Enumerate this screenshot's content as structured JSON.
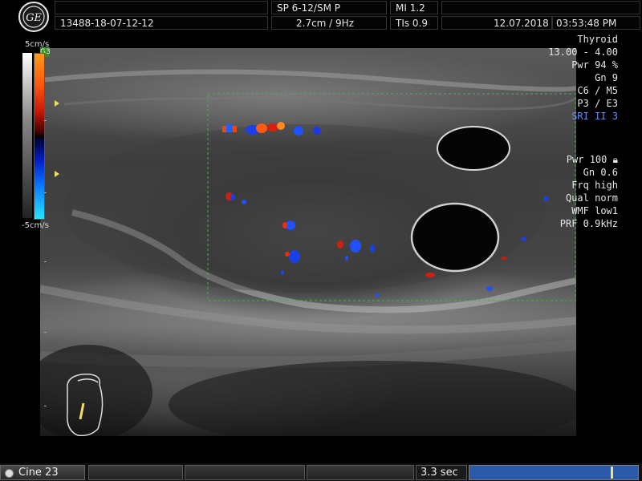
{
  "header": {
    "logo_icon": "ge-logo-icon",
    "logo_text": "GE",
    "probe": "SP 6-12/SM P",
    "mi": "MI 1.2",
    "patient_id": "13488-18-07-12-12",
    "depth_freq": "2.7cm / 9Hz",
    "tis": "TIs 0.9",
    "date": "12.07.2018",
    "time": "03:53:48 PM"
  },
  "color_scale": {
    "top_label": "5cm/s",
    "bottom_label": "-5cm/s",
    "badge": "G3",
    "colors": {
      "positive": "#ff5a10",
      "negative": "#0a78ff",
      "marker": "#f0e060"
    }
  },
  "params_top": [
    "Thyroid",
    "13.00 - 4.00",
    "Pwr  94 %",
    "Gn  9",
    "C6 / M5",
    "P3 / E3",
    "SRI II 3"
  ],
  "params_color": [
    "Pwr 100",
    "Gn  0.6",
    "Frq high",
    "Qual norm",
    "WMF low1",
    "PRF  0.9kHz"
  ],
  "lock_icon": "lock-icon",
  "bottom": {
    "cine_label": "Cine 23",
    "seconds": "3.3 sec",
    "cine_position_fraction": 0.85
  },
  "colors": {
    "roi_box": "#4caf50",
    "cine_track": "#2a5aa8",
    "highlight_text": "#6a8cff"
  }
}
